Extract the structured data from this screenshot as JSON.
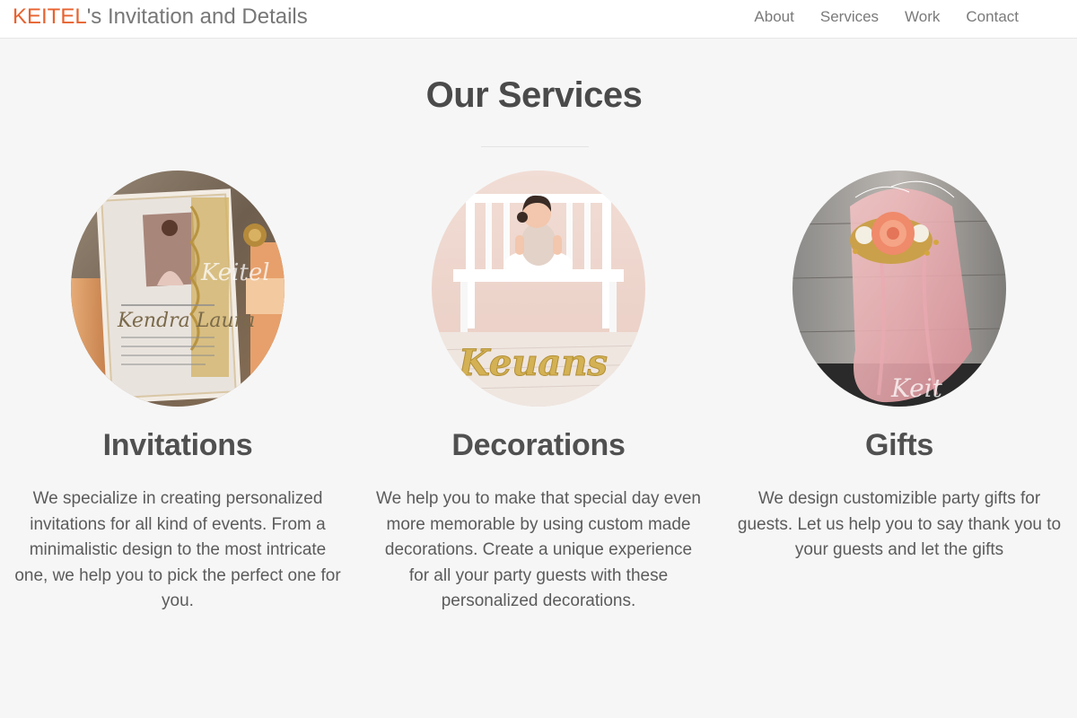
{
  "brand": {
    "accent": "KEITEL",
    "rest": "'s Invitation and Details"
  },
  "nav": {
    "items": [
      "About",
      "Services",
      "Work",
      "Contact"
    ]
  },
  "section": {
    "title": "Our Services"
  },
  "services": [
    {
      "title": "Invitations",
      "text": "We specialize in creating personalized invitations for all kind of events. From a minimalistic design to the most intricate one, we help you to pick the perfect one for you.",
      "photo": {
        "card_script": "Kendra Laura",
        "watermark": "Keitel"
      }
    },
    {
      "title": "Decorations",
      "text": "We help you to make that special day even more memorable by using custom made decorations. Create a unique experience for all your party guests with these personalized decorations.",
      "photo": {
        "sign_text": "Keuans"
      }
    },
    {
      "title": "Gifts",
      "text": "We design customizible party gifts for guests. Let us help you to say thank you to your guests and let the gifts",
      "photo": {
        "watermark": "Keit"
      }
    }
  ],
  "colors": {
    "accent": "#e8622f",
    "background": "#f6f6f6",
    "heading": "#4a4a4a"
  }
}
